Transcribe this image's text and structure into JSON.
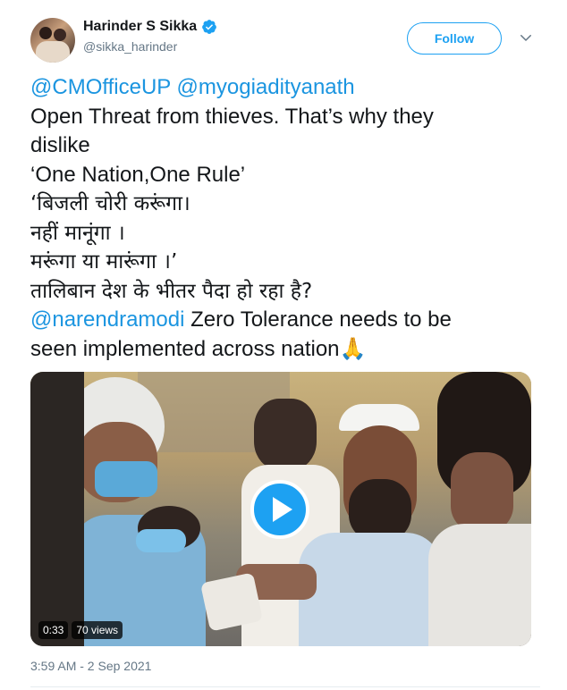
{
  "author": {
    "display_name": "Harinder S Sikka",
    "handle": "@sikka_harinder",
    "verified": true
  },
  "actions": {
    "follow_label": "Follow"
  },
  "tweet": {
    "lines": [
      {
        "mention1": "@CMOfficeUP",
        "mention2": "@myogiadityanath"
      },
      {
        "text": "Open Threat from thieves. That’s why they"
      },
      {
        "text": "dislike"
      },
      {
        "text": "‘One Nation,One Rule’"
      },
      {
        "text": "‘बिजली चोरी करूंगा।"
      },
      {
        "text": "नहीं मानूंगा ।"
      },
      {
        "text": "मरूंगा या मारूंगा ।’"
      },
      {
        "text": "तालिबान देश के भीतर पैदा हो रहा है?"
      },
      {
        "mention": "@narendramodi",
        "text": " Zero Tolerance needs to be"
      },
      {
        "text": "seen implemented across nation",
        "emoji": "🙏"
      }
    ]
  },
  "media": {
    "duration": "0:33",
    "views": "70 views"
  },
  "timestamp": "3:59 AM - 2 Sep 2021",
  "colors": {
    "accent": "#1da1f2",
    "mention": "#1b95e0",
    "secondary_text": "#657786"
  },
  "icons": {
    "verified": "verified-badge-icon",
    "more": "chevron-down-icon",
    "play": "play-icon"
  }
}
